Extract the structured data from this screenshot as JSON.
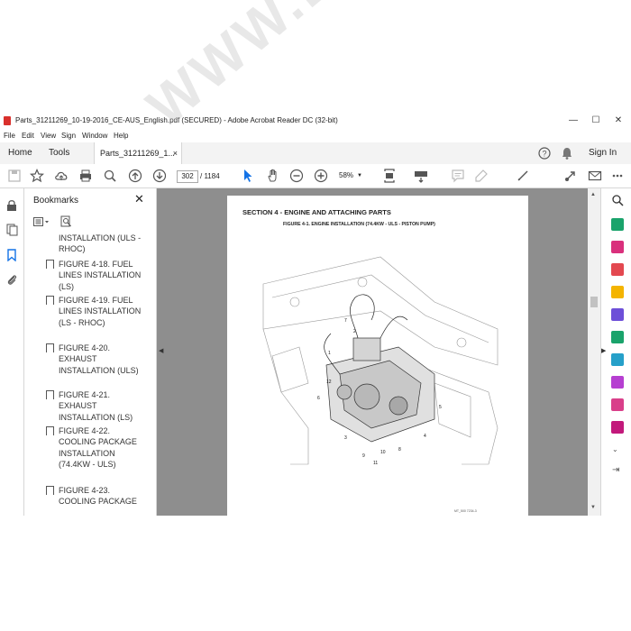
{
  "window": {
    "title": "Parts_31211269_10-19-2016_CE-AUS_English.pdf (SECURED) - Adobe Acrobat Reader DC (32-bit)",
    "controls": {
      "minimize": "—",
      "maximize": "☐",
      "close": "✕"
    }
  },
  "menu": [
    "File",
    "Edit",
    "View",
    "Sign",
    "Window",
    "Help"
  ],
  "tabs": {
    "home": "Home",
    "tools": "Tools",
    "document": "Parts_31211269_1...",
    "close": "×",
    "sign_in": "Sign In"
  },
  "toolbar": {
    "current_page": "302",
    "page_sep_total": "/ 1184",
    "zoom": "58%"
  },
  "bookmarks": {
    "title": "Bookmarks",
    "close": "✕",
    "items": [
      "INSTALLATION (ULS - RHOC)",
      "FIGURE 4-18. FUEL LINES INSTALLATION (LS)",
      "FIGURE 4-19. FUEL LINES INSTALLATION (LS - RHOC)",
      "FIGURE 4-20. EXHAUST INSTALLATION (ULS)",
      "FIGURE 4-21. EXHAUST INSTALLATION (LS)",
      "FIGURE 4-22. COOLING PACKAGE INSTALLATION (74.4KW - ULS)",
      "FIGURE 4-23. COOLING PACKAGE"
    ]
  },
  "document": {
    "section_title": "SECTION 4 - ENGINE AND ATTACHING PARTS",
    "figure_title": "FIGURE 4-1. ENGINE INSTALLATION (74.4KW - ULS - PISTON PUMP)",
    "figure_code": "MT_500 7234-3",
    "callouts": [
      "1",
      "2",
      "3",
      "4",
      "5",
      "6",
      "7",
      "8",
      "9",
      "10",
      "11",
      "12"
    ]
  },
  "watermark": "WWW.EPCATEPO.COM",
  "colors": {
    "tab_bg": "#f3f3f3",
    "doc_bg": "#8e8e8e",
    "accent": "#1473e6"
  }
}
